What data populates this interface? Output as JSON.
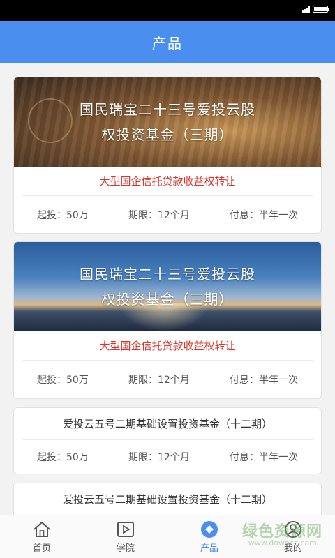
{
  "header": {
    "title": "产品"
  },
  "products": [
    {
      "banner_line1": "国民瑞宝二十三号爱投云股",
      "banner_line2": "权投资基金（三期）",
      "subtitle": "大型国企信托贷款收益权转让",
      "min_invest": "起投：50万",
      "term": "期限：12个月",
      "interest": "付息：半年一次"
    },
    {
      "banner_line1": "国民瑞宝二十三号爱投云股",
      "banner_line2": "权投资基金（三期）",
      "subtitle": "大型国企信托贷款收益权转让",
      "min_invest": "起投：50万",
      "term": "期限：12个月",
      "interest": "付息：半年一次"
    },
    {
      "title": "爱投云五号二期基础设置投资基金（十二期）",
      "min_invest": "起投：50万",
      "term": "期限：12个月",
      "interest": "付息：半年一次"
    },
    {
      "title": "爱投云五号二期基础设置投资基金（十二期）"
    }
  ],
  "nav": [
    {
      "label": "首页",
      "icon": "home-icon"
    },
    {
      "label": "学院",
      "icon": "play-icon"
    },
    {
      "label": "产品",
      "icon": "product-icon",
      "active": true
    },
    {
      "label": "我的",
      "icon": "user-icon"
    }
  ],
  "watermark": {
    "text": "绿色资源网",
    "sub": "www.downcc.com"
  },
  "colors": {
    "header": "#4a8ef0",
    "accent_red": "#d8352c",
    "nav_active": "#4a8ef0"
  }
}
